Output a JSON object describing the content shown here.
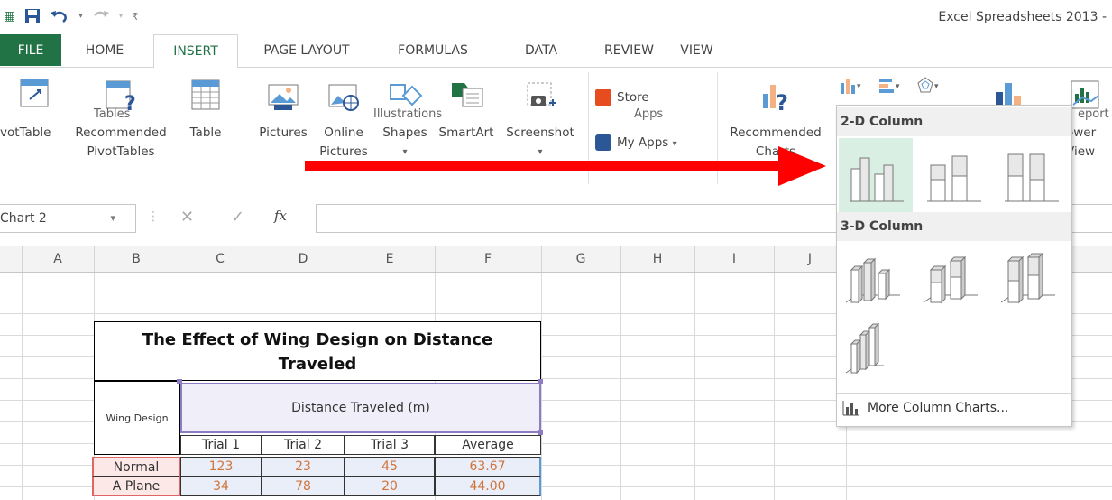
{
  "window": {
    "title": "Excel Spreadsheets 2013 -"
  },
  "tabs": [
    {
      "label": "FILE"
    },
    {
      "label": "HOME"
    },
    {
      "label": "INSERT"
    },
    {
      "label": "PAGE LAYOUT"
    },
    {
      "label": "FORMULAS"
    },
    {
      "label": "DATA"
    },
    {
      "label": "REVIEW"
    },
    {
      "label": "VIEW"
    }
  ],
  "ribbon": {
    "pivottable": "votTable",
    "recommended_pivot_1": "Recommended",
    "recommended_pivot_2": "PivotTables",
    "table": "Table",
    "pictures": "Pictures",
    "online_1": "Online",
    "online_2": "Pictures",
    "shapes": "Shapes",
    "smartart": "SmartArt",
    "screenshot": "Screenshot",
    "store": "Store",
    "myapps": "My Apps",
    "rec_charts_1": "Recommended",
    "rec_charts_2": "Charts",
    "power_1": "ower",
    "power_2": "View",
    "groups": {
      "tables": "Tables",
      "illustrations": "Illustrations",
      "apps": "Apps",
      "reports": "eport"
    }
  },
  "formula_bar": {
    "name_box": "Chart 2",
    "fx": "fx",
    "value": ""
  },
  "columns": [
    "A",
    "B",
    "C",
    "D",
    "E",
    "F",
    "G",
    "H",
    "I",
    "J"
  ],
  "table": {
    "title_line1": "The Effect of Wing Design on Distance",
    "title_line2": "Traveled",
    "wing_design": "Wing Design",
    "distance_header": "Distance Traveled (m)",
    "subheaders": [
      "Trial 1",
      "Trial 2",
      "Trial 3",
      "Average"
    ],
    "rows": [
      {
        "label": "Normal",
        "values": [
          "123",
          "23",
          "45",
          "63.67"
        ]
      },
      {
        "label": "A Plane",
        "values": [
          "34",
          "78",
          "20",
          "44.00"
        ]
      }
    ]
  },
  "dropdown": {
    "section_2d": "2-D Column",
    "section_3d": "3-D Column",
    "more": "More Column Charts..."
  },
  "colors": {
    "excel_green": "#217346",
    "accent_text": "#d0743c",
    "arrow": "#ff0000",
    "table_purple": "#8e7cc3",
    "table_red": "#e06666"
  }
}
